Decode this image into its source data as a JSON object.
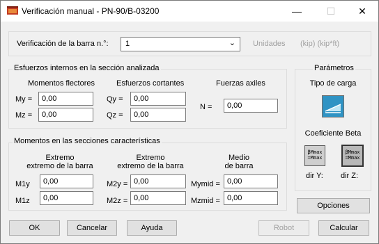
{
  "window": {
    "title": "Verificación manual - PN-90/B-03200",
    "minimize_glyph": "—",
    "maximize_glyph": "☐",
    "close_glyph": "✕"
  },
  "bar_check": {
    "label": "Verificación de la barra n.°:",
    "value": "1",
    "units_label": "Unidades",
    "units_value": "(kip) (kip*ft)"
  },
  "internal_forces": {
    "legend": "Esfuerzos internos en la sección analizada",
    "bending_header": "Momentos flectores",
    "shear_header": "Esfuerzos cortantes",
    "axial_header": "Fuerzas axiles",
    "my_label": "My =",
    "my_value": "0,00",
    "mz_label": "Mz =",
    "mz_value": "0,00",
    "qy_label": "Qy =",
    "qy_value": "0,00",
    "qz_label": "Qz =",
    "qz_value": "0,00",
    "n_label": "N =",
    "n_value": "0,00"
  },
  "section_moments": {
    "legend": "Momentos en las secciones características",
    "col1_header_l1": "Extremo",
    "col1_header_l2": "extremo de la barra",
    "col2_header_l1": "Extremo",
    "col2_header_l2": "extremo de la barra",
    "col3_header_l1": "Medio",
    "col3_header_l2": "de barra",
    "m1y_label": "M1y",
    "m1y_value": "0,00",
    "m1z_label": "M1z",
    "m1z_value": "0,00",
    "m2y_label": "M2y =",
    "m2y_value": "0,00",
    "m2z_label": "M2z =",
    "m2z_value": "0,00",
    "mymid_label": "Mymid =",
    "mymid_value": "0,00",
    "mzmid_label": "Mzmid =",
    "mzmid_value": "0,00"
  },
  "parameters": {
    "legend": "Parámetros",
    "load_type_label": "Tipo de carga",
    "beta_label": "Coeficiente Beta",
    "beta_icon_text_l1": "βMmax",
    "beta_icon_text_l2": "=Mmax",
    "dir_y_label": "dir Y:",
    "dir_z_label": "dir Z:",
    "options_button": "Opciones"
  },
  "footer": {
    "ok": "OK",
    "cancel": "Cancelar",
    "help": "Ayuda",
    "robot": "Robot",
    "calculate": "Calcular"
  }
}
